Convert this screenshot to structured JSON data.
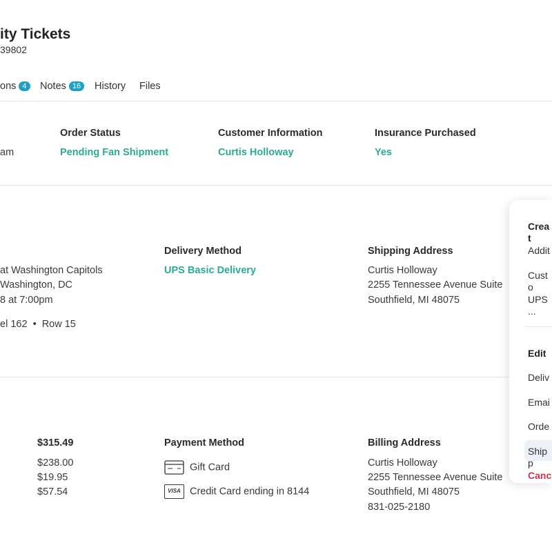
{
  "header": {
    "title": "ity Tickets",
    "subtitle": "39802"
  },
  "tabs": [
    {
      "label": "ons",
      "badge": "4"
    },
    {
      "label": "Notes",
      "badge": "16"
    },
    {
      "label": "History"
    },
    {
      "label": "Files"
    }
  ],
  "summary": {
    "first_value": "am",
    "order_status": {
      "label": "Order Status",
      "value": "Pending Fan Shipment"
    },
    "customer": {
      "label": "Customer Information",
      "value": "Curtis Holloway"
    },
    "insurance": {
      "label": "Insurance Purchased",
      "value": "Yes"
    }
  },
  "event": {
    "lines": [
      "at Washington Capitols",
      "Washington, DC",
      "8 at 7:00pm"
    ],
    "seat": "el 162  •  Row 15"
  },
  "delivery": {
    "label": "Delivery Method",
    "value": "UPS Basic Delivery"
  },
  "shipping": {
    "label": "Shipping Address",
    "lines": [
      "Curtis Holloway",
      "2255 Tennessee Avenue Suite",
      "Southfield, MI 48075"
    ]
  },
  "totals": {
    "total": "$315.49",
    "items": [
      "$238.00",
      "$19.95",
      "$57.54"
    ]
  },
  "payment": {
    "label": "Payment Method",
    "methods": [
      {
        "icon": "gift-card-icon",
        "label": "Gift Card"
      },
      {
        "icon": "visa-icon",
        "label": "Credit Card ending in 8144",
        "icon_text": "VISA"
      }
    ]
  },
  "billing": {
    "label": "Billing Address",
    "lines": [
      "Curtis Holloway",
      "2255 Tennessee Avenue Suite",
      "Southfield, MI 48075",
      "831-025-2180"
    ]
  },
  "menu": {
    "create_heading": "Creat",
    "create_items": [
      "Addit",
      "Custo",
      "UPS ..."
    ],
    "edit_heading": "Edit",
    "edit_items": [
      "Deliv",
      "Emai",
      "Orde",
      "Shipp"
    ],
    "cancel": "Canc"
  },
  "colors": {
    "accent": "#2aab93",
    "badge": "#1e9fc4",
    "danger": "#d0344a"
  }
}
